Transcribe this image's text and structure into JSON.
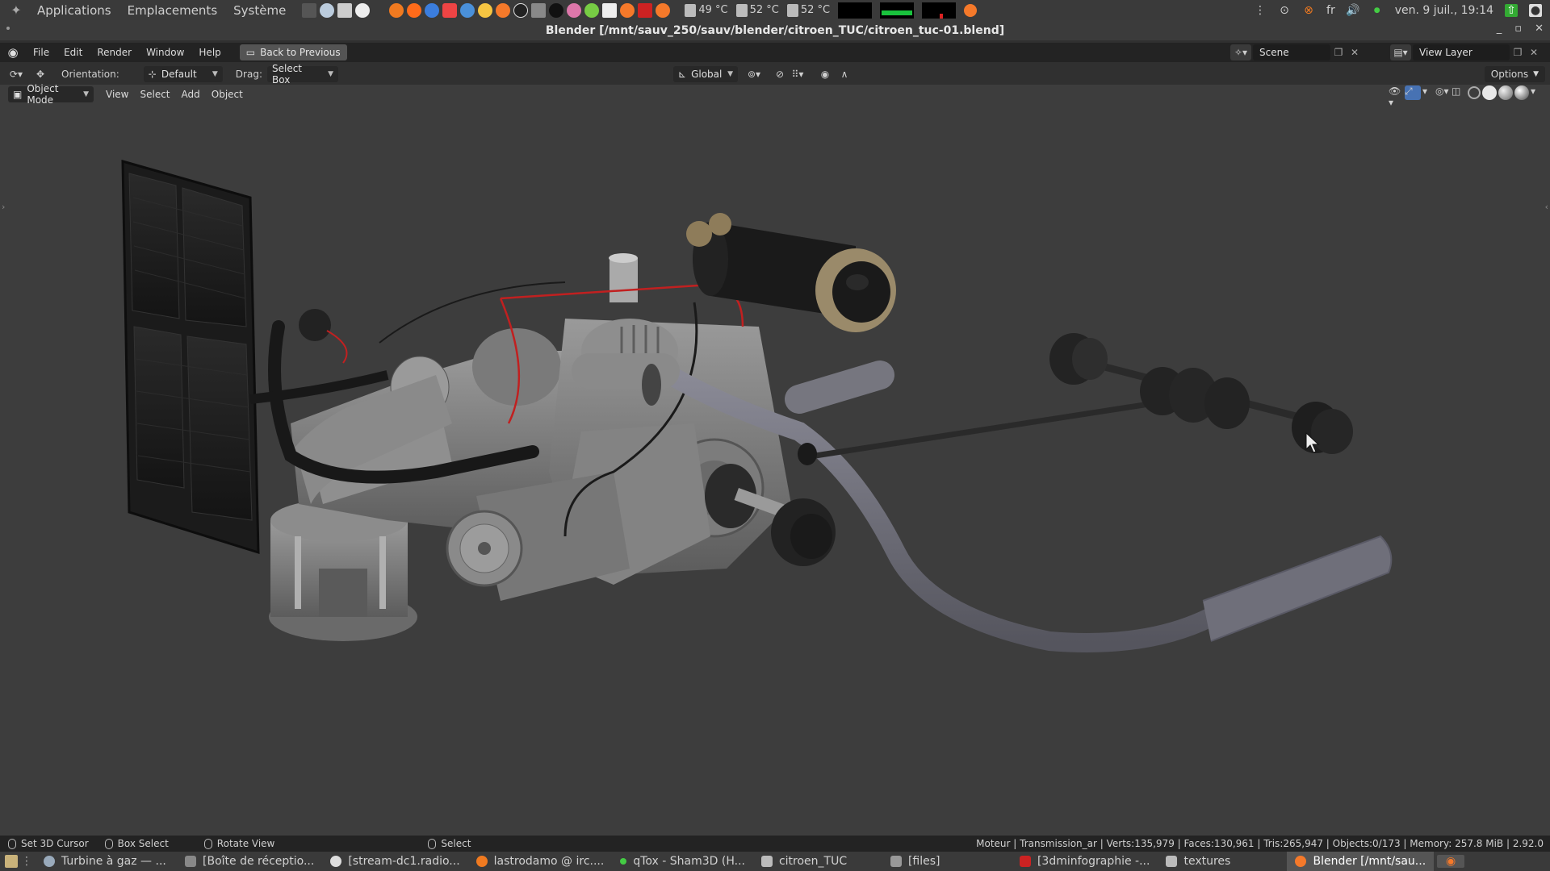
{
  "os_panel": {
    "menus": [
      "Applications",
      "Emplacements",
      "Système"
    ],
    "temps": [
      "49 °C",
      "52 °C",
      "52 °C"
    ],
    "lang": "fr",
    "clock": "ven. 9 juil., 19:14"
  },
  "window": {
    "title": "Blender [/mnt/sauv_250/sauv/blender/citroen_TUC/citroen_tuc-01.blend]"
  },
  "topbar": {
    "menus": [
      "File",
      "Edit",
      "Render",
      "Window",
      "Help"
    ],
    "back_label": "Back to Previous",
    "scene": "Scene",
    "view_layer": "View Layer"
  },
  "tool_header": {
    "orientation_label": "Orientation:",
    "orientation_value": "Default",
    "drag_label": "Drag:",
    "drag_value": "Select Box",
    "transform_orientation": "Global",
    "options_label": "Options"
  },
  "viewport_header": {
    "mode": "Object Mode",
    "menus": [
      "View",
      "Select",
      "Add",
      "Object"
    ]
  },
  "statusbar": {
    "hints": [
      "Set 3D Cursor",
      "Box Select",
      "Rotate View",
      "Select"
    ],
    "stats": "Moteur | Transmission_ar | Verts:135,979 | Faces:130,961 | Tris:265,947 | Objects:0/173 | Memory: 257.8 MiB | 2.92.0"
  },
  "taskbar": {
    "tasks": [
      "Turbine à gaz — ...",
      "[Boîte de réceptio...",
      "[stream-dc1.radio...",
      "lastrodamo @ irc....",
      "qTox - Sham3D (H...",
      "citroen_TUC",
      "[files]",
      "[3dminfographie -...",
      "textures",
      "Blender [/mnt/sau..."
    ]
  },
  "colors": {
    "viewport_bg": "#3d3d3d",
    "header_bg": "#232323",
    "accent_blue": "#4772b3"
  }
}
